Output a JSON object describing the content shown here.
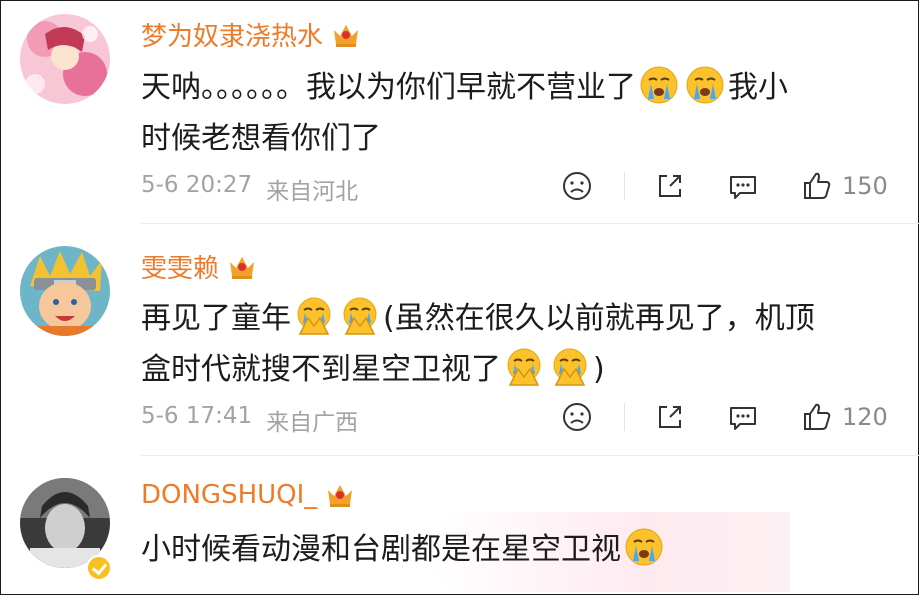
{
  "comments": [
    {
      "user": "梦为奴隶浇热水",
      "text_line1": "天呐。。。。。。我以为你们早就不营业了",
      "text_tail1": "我小",
      "text_line2": "时候老想看你们了",
      "time": "5-6 20:27",
      "location": "来自河北",
      "likes": "150"
    },
    {
      "user": "雯雯赖",
      "text_line1a": "再见了童年",
      "text_line1b": "(虽然在很久以前就再见了，机顶",
      "text_line2": "盒时代就搜不到星空卫视了",
      "text_tail2": ")",
      "time": "5-6 17:41",
      "location": "来自广西",
      "likes": "120"
    },
    {
      "user": "DONGSHUQI_",
      "text_line1": "小时候看动漫和台剧都是在星空卫视"
    }
  ],
  "icons": {
    "crown": "crown-badge-icon",
    "crying": "crying-face-emoji",
    "praying": "tearful-praying-emoji",
    "dislike": "frown-face-icon",
    "share": "share-icon",
    "comment": "comment-icon",
    "like": "thumbs-up-icon",
    "verified": "verified-badge-icon"
  },
  "colors": {
    "username": "#ef7a2a",
    "meta": "#a3a3a3",
    "text": "#1c1c1c",
    "crown": "#f2a12a",
    "verified": "#f8c021"
  }
}
